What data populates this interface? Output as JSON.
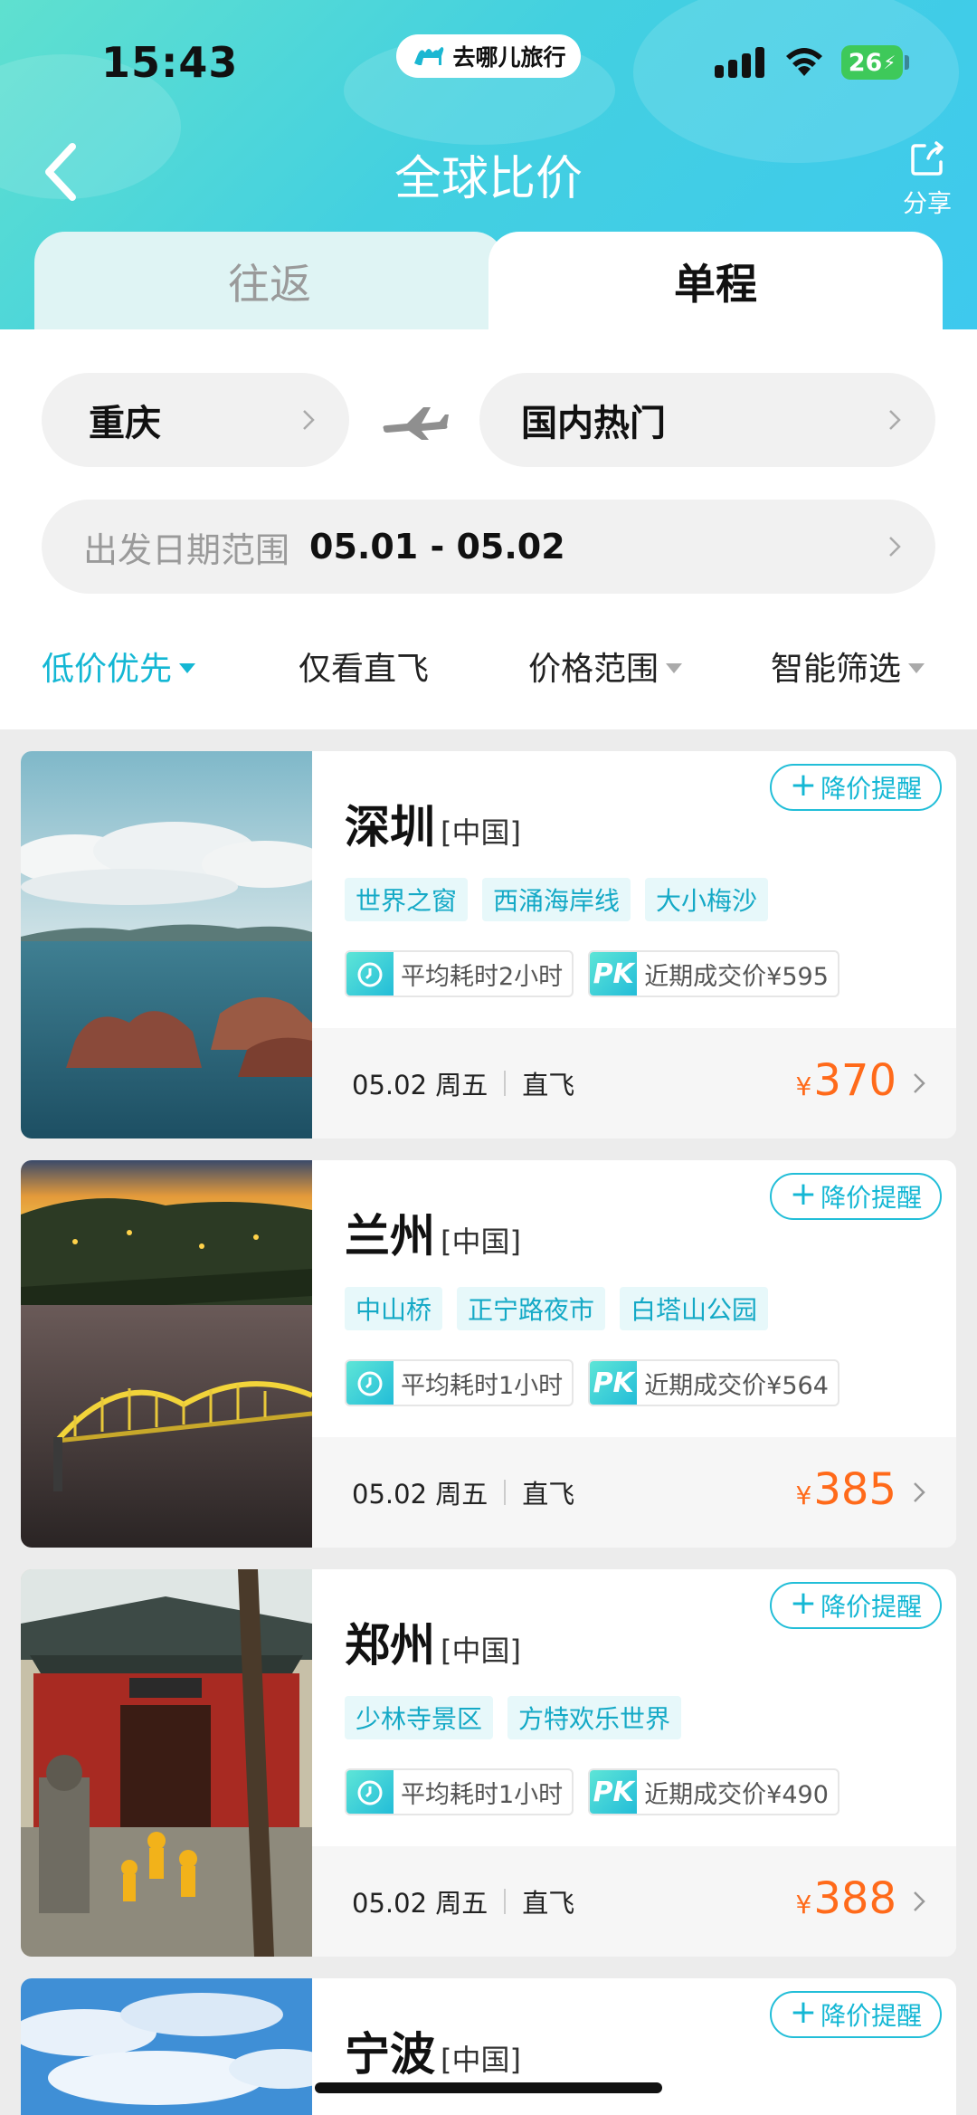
{
  "status_bar": {
    "time": "15:43",
    "app_pill": "去哪儿旅行",
    "battery": "26"
  },
  "header": {
    "title": "全球比价",
    "share_label": "分享",
    "tabs": [
      {
        "label": "往返",
        "active": false
      },
      {
        "label": "单程",
        "active": true
      }
    ]
  },
  "search": {
    "from_city": "重庆",
    "to_city": "国内热门",
    "date_label": "出发日期范围",
    "date_value": "05.01 - 05.02"
  },
  "filters": [
    {
      "label": "低价优先",
      "active": true,
      "dropdown": true
    },
    {
      "label": "仅看直飞",
      "active": false,
      "dropdown": false
    },
    {
      "label": "价格范围",
      "active": false,
      "dropdown": true
    },
    {
      "label": "智能筛选",
      "active": false,
      "dropdown": true
    }
  ],
  "results": [
    {
      "city": "深圳",
      "country": "[中国]",
      "tags": [
        "世界之窗",
        "西涌海岸线",
        "大小梅沙"
      ],
      "duration": "平均耗时2小时",
      "recent_price": "近期成交价¥595",
      "date": "05.02 周五",
      "flight": "直飞",
      "currency": "¥",
      "price": "370",
      "alert_label": "降价提醒"
    },
    {
      "city": "兰州",
      "country": "[中国]",
      "tags": [
        "中山桥",
        "正宁路夜市",
        "白塔山公园"
      ],
      "duration": "平均耗时1小时",
      "recent_price": "近期成交价¥564",
      "date": "05.02 周五",
      "flight": "直飞",
      "currency": "¥",
      "price": "385",
      "alert_label": "降价提醒"
    },
    {
      "city": "郑州",
      "country": "[中国]",
      "tags": [
        "少林寺景区",
        "方特欢乐世界"
      ],
      "duration": "平均耗时1小时",
      "recent_price": "近期成交价¥490",
      "date": "05.02 周五",
      "flight": "直飞",
      "currency": "¥",
      "price": "388",
      "alert_label": "降价提醒"
    },
    {
      "city": "宁波",
      "country": "[中国]",
      "tags": [],
      "alert_label": "降价提醒"
    }
  ],
  "meta_icon_pk": "PK",
  "colors": {
    "accent": "#14b7d4",
    "price": "#ff6a1a",
    "header_gradient_start": "#5fe0cf",
    "header_gradient_end": "#3ec9ee"
  }
}
